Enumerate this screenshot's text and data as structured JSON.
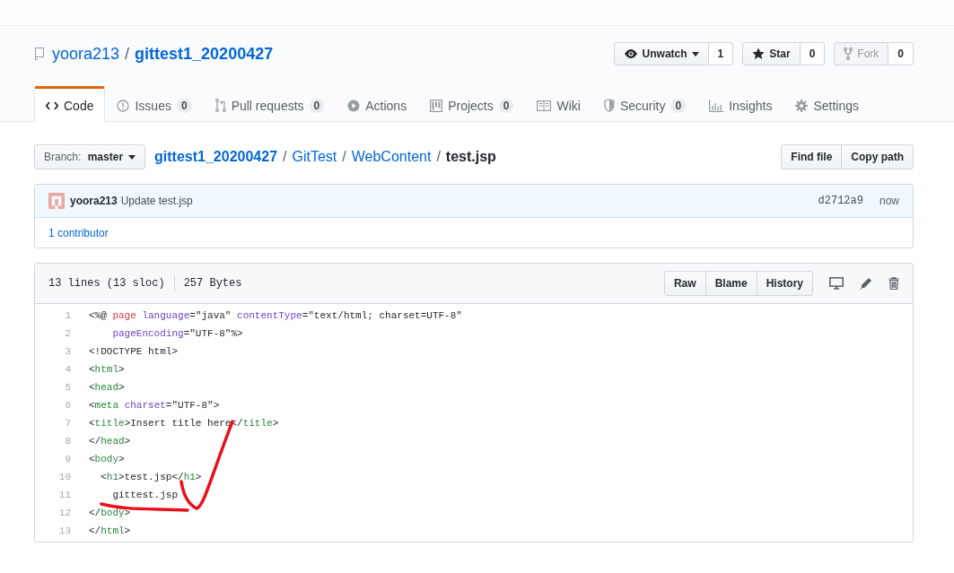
{
  "repo": {
    "owner": "yoora213",
    "separator": "/",
    "name": "gittest1_20200427"
  },
  "actions": [
    {
      "kind": "watch",
      "label": "Unwatch",
      "count": "1",
      "disabled": false
    },
    {
      "kind": "star",
      "label": "Star",
      "count": "0",
      "disabled": false
    },
    {
      "kind": "fork",
      "label": "Fork",
      "count": "0",
      "disabled": true
    }
  ],
  "tabs": [
    {
      "label": "Code",
      "selected": true
    },
    {
      "label": "Issues",
      "counter": "0",
      "selected": false
    },
    {
      "label": "Pull requests",
      "counter": "0",
      "selected": false
    },
    {
      "label": "Actions",
      "selected": false
    },
    {
      "label": "Projects",
      "counter": "0",
      "selected": false
    },
    {
      "label": "Wiki",
      "selected": false
    },
    {
      "label": "Security",
      "counter": "0",
      "selected": false
    },
    {
      "label": "Insights",
      "selected": false
    },
    {
      "label": "Settings",
      "selected": false
    }
  ],
  "branch": {
    "label": "Branch:",
    "value": "master"
  },
  "breadcrumb": [
    {
      "text": "gittest1_20200427",
      "kind": "root"
    },
    {
      "text": "GitTest",
      "kind": "dir"
    },
    {
      "text": "WebContent",
      "kind": "dir"
    },
    {
      "text": "test.jsp",
      "kind": "file"
    }
  ],
  "breadcrumb_separator": "/",
  "file_buttons": [
    "Find file",
    "Copy path"
  ],
  "commit": {
    "author": "yoora213",
    "message": "Update test.jsp",
    "sha": "d2712a9",
    "time": "now"
  },
  "contributors": {
    "count": "1",
    "label": "contributor"
  },
  "file": {
    "lines": "13 lines (13 sloc)",
    "size": "257 Bytes",
    "buttons": [
      "Raw",
      "Blame",
      "History"
    ],
    "code": [
      {
        "number": "1",
        "tokens": [
          {
            "kind": "plain",
            "text": "<%@ "
          },
          {
            "kind": "keyword",
            "text": "page "
          },
          {
            "kind": "attr",
            "text": "language"
          },
          {
            "kind": "plain",
            "text": "=\"java\" "
          },
          {
            "kind": "attr",
            "text": "contentType"
          },
          {
            "kind": "plain",
            "text": "=\"text/html; charset=UTF-8\""
          }
        ]
      },
      {
        "number": "2",
        "tokens": [
          {
            "kind": "attr",
            "text": "    pageEncoding"
          },
          {
            "kind": "plain",
            "text": "=\"UTF-8\"%>"
          }
        ]
      },
      {
        "number": "3",
        "tokens": [
          {
            "kind": "plain",
            "text": "<!DOCTYPE html>"
          }
        ]
      },
      {
        "number": "4",
        "tokens": [
          {
            "kind": "plain",
            "text": "<"
          },
          {
            "kind": "tag",
            "text": "html"
          },
          {
            "kind": "plain",
            "text": ">"
          }
        ]
      },
      {
        "number": "5",
        "tokens": [
          {
            "kind": "plain",
            "text": "<"
          },
          {
            "kind": "tag",
            "text": "head"
          },
          {
            "kind": "plain",
            "text": ">"
          }
        ]
      },
      {
        "number": "6",
        "tokens": [
          {
            "kind": "plain",
            "text": "<"
          },
          {
            "kind": "tag",
            "text": "meta "
          },
          {
            "kind": "attr",
            "text": "charset"
          },
          {
            "kind": "plain",
            "text": "=\"UTF-8\">"
          }
        ]
      },
      {
        "number": "7",
        "tokens": [
          {
            "kind": "plain",
            "text": "<"
          },
          {
            "kind": "tag",
            "text": "title"
          },
          {
            "kind": "plain",
            "text": ">Insert title here</"
          },
          {
            "kind": "tag",
            "text": "title"
          },
          {
            "kind": "plain",
            "text": ">"
          }
        ]
      },
      {
        "number": "8",
        "tokens": [
          {
            "kind": "plain",
            "text": "</"
          },
          {
            "kind": "tag",
            "text": "head"
          },
          {
            "kind": "plain",
            "text": ">"
          }
        ]
      },
      {
        "number": "9",
        "tokens": [
          {
            "kind": "plain",
            "text": "<"
          },
          {
            "kind": "tag",
            "text": "body"
          },
          {
            "kind": "plain",
            "text": ">"
          }
        ]
      },
      {
        "number": "10",
        "tokens": [
          {
            "kind": "plain",
            "text": "  <"
          },
          {
            "kind": "tag",
            "text": "h1"
          },
          {
            "kind": "plain",
            "text": ">test.jsp</"
          },
          {
            "kind": "tag",
            "text": "h1"
          },
          {
            "kind": "plain",
            "text": ">"
          }
        ]
      },
      {
        "number": "11",
        "tokens": [
          {
            "kind": "plain",
            "text": "    gittest.jsp"
          }
        ]
      },
      {
        "number": "12",
        "tokens": [
          {
            "kind": "plain",
            "text": "</"
          },
          {
            "kind": "tag",
            "text": "body"
          },
          {
            "kind": "plain",
            "text": ">"
          }
        ]
      },
      {
        "number": "13",
        "tokens": [
          {
            "kind": "plain",
            "text": "</"
          },
          {
            "kind": "tag",
            "text": "html"
          },
          {
            "kind": "plain",
            "text": ">"
          }
        ]
      }
    ]
  }
}
